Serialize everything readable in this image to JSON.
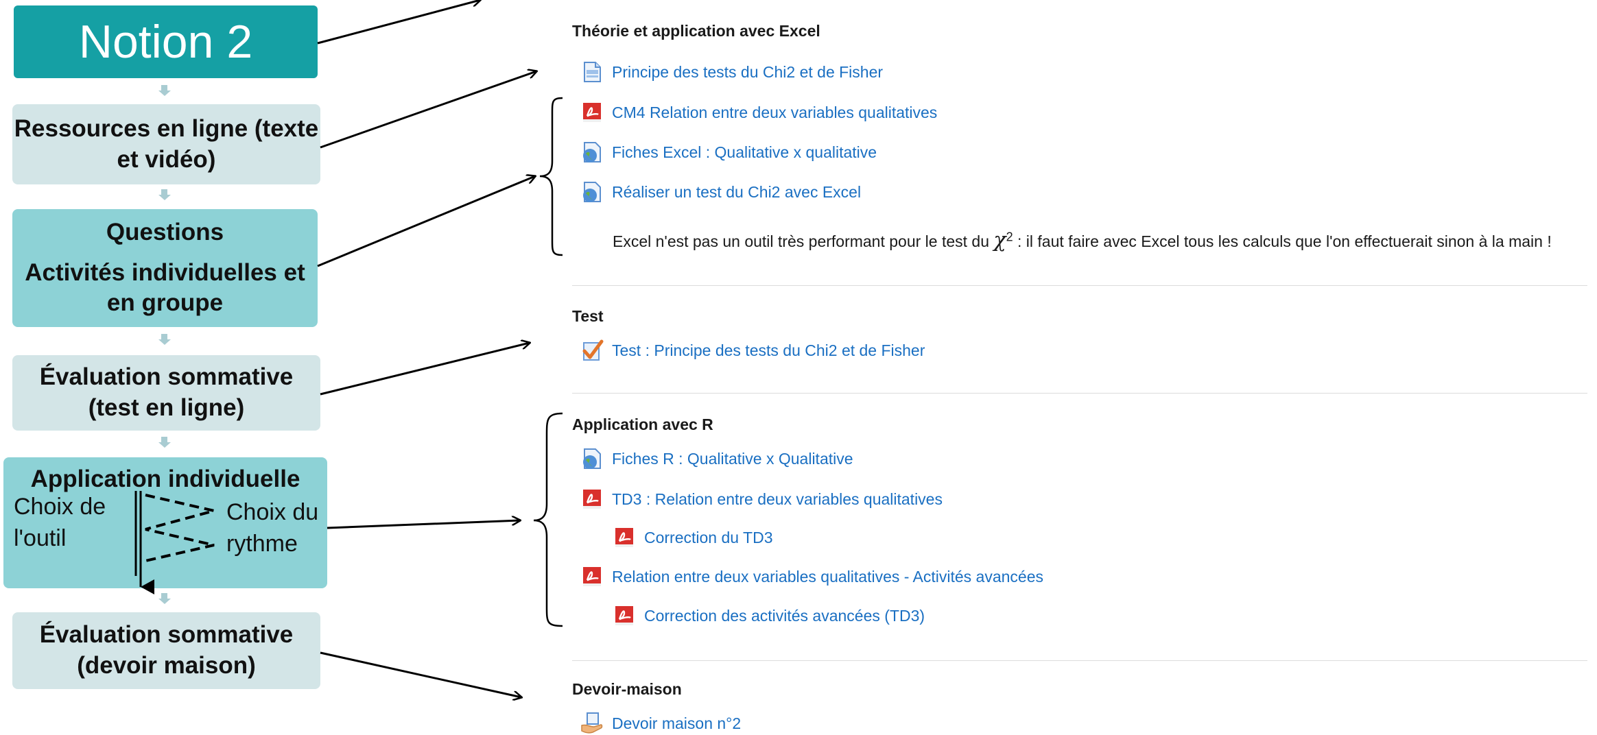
{
  "flow": {
    "notion": "Notion 2",
    "box2": [
      "Ressources en ligne (texte",
      "et vidéo)"
    ],
    "box3": [
      "Questions",
      "Activités individuelles et",
      "en groupe"
    ],
    "box4": [
      "Évaluation sommative",
      "(test en ligne)"
    ],
    "box5_title": "Application individuelle",
    "box5_left": [
      "Choix de",
      "l'outil"
    ],
    "box5_right": [
      "Choix du",
      "rythme"
    ],
    "box6": [
      "Évaluation sommative",
      "(devoir maison)"
    ]
  },
  "sections": {
    "s1_title": "Théorie et application avec Excel",
    "s1_items": [
      {
        "label": "Principe des tests du Chi2 et de Fisher",
        "icon": "page-icon"
      },
      {
        "label": "CM4 Relation entre deux variables qualitatives",
        "icon": "pdf-icon"
      },
      {
        "label": "Fiches Excel : Qualitative x qualitative",
        "icon": "url-globe-icon"
      },
      {
        "label": "Réaliser un test du Chi2 avec Excel",
        "icon": "url-globe-icon"
      }
    ],
    "s1_note_before": "Excel n'est pas un outil très performant pour le test du ",
    "s1_note_symbol": "χ",
    "s1_note_sup": "2",
    "s1_note_after": " : il faut faire avec Excel tous les calculs que l'on effectuerait sinon à la main !",
    "s2_title": "Test",
    "s2_items": [
      {
        "label": "Test : Principe des tests du Chi2 et de Fisher",
        "icon": "quiz-check-icon"
      }
    ],
    "s3_title": "Application avec R",
    "s3_items": [
      {
        "label": "Fiches R : Qualitative x Qualitative",
        "icon": "url-globe-icon"
      },
      {
        "label": "TD3 : Relation entre deux variables qualitatives",
        "icon": "pdf-icon"
      },
      {
        "label": "Correction du TD3",
        "icon": "pdf-icon"
      },
      {
        "label": "Relation entre deux variables qualitatives - Activités avancées",
        "icon": "pdf-icon"
      },
      {
        "label": "Correction des activités avancées (TD3)",
        "icon": "pdf-icon"
      }
    ],
    "s4_title": "Devoir-maison",
    "s4_items": [
      {
        "label": "Devoir maison n°2",
        "icon": "assignment-hand-icon"
      }
    ]
  },
  "colors": {
    "notion_bg": "#15a0a4",
    "light_box": "#d3e5e7",
    "teal_box": "#8dd2d6",
    "link": "#1a6fc2"
  }
}
